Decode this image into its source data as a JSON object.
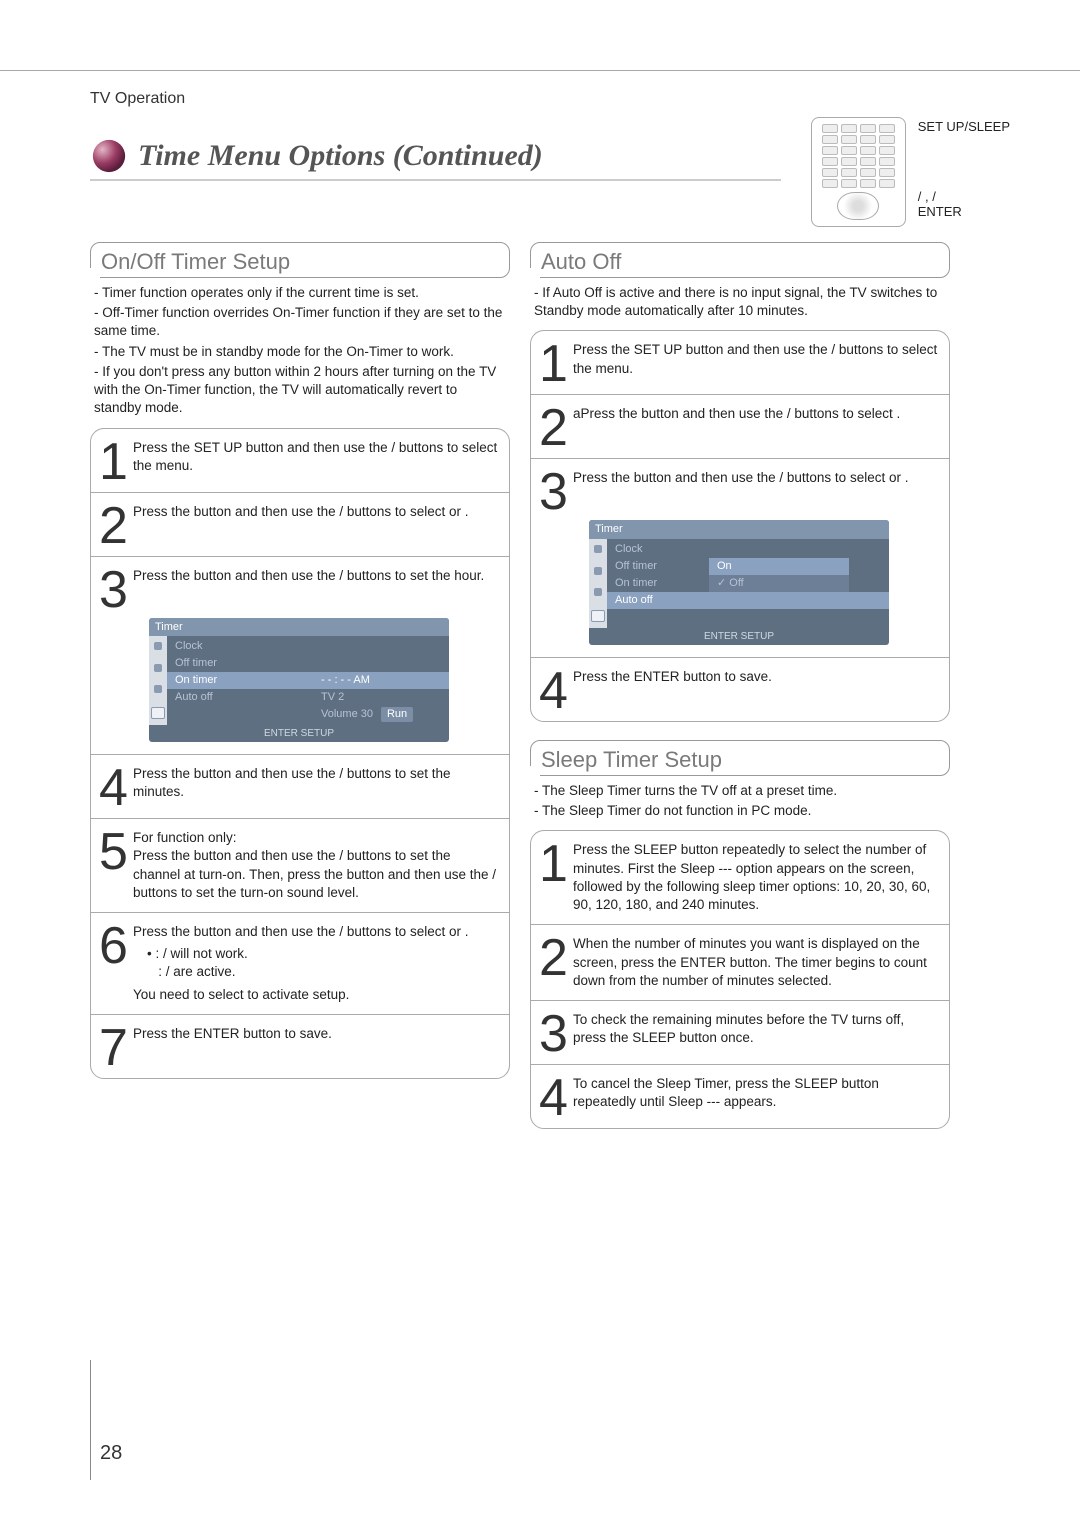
{
  "breadcrumb": "TV Operation",
  "page_title": "Time Menu Options (Continued)",
  "page_number": "28",
  "remote": {
    "label1": "SET UP/SLEEP",
    "label2": "/   ,     /",
    "label3": "ENTER"
  },
  "onoff": {
    "heading": "On/Off Timer Setup",
    "intro": [
      "Timer function operates only if the current time is set.",
      "Off-Timer function overrides On-Timer function if they are set to the same time.",
      "The TV must be in standby mode for the On-Timer to work.",
      "If you don't press any button within 2 hours after turning on the TV with the On-Timer function, the TV will automatically revert to standby mode."
    ],
    "steps": [
      "Press the SET UP button and then use the      /      buttons to select the           menu.",
      "Press the        button and then use the      /      buttons to select                 or               .",
      "Press the        button and then use the      /      buttons to set the hour.",
      "Press the        button and then use the      /      buttons to set the minutes.",
      "For               function only:\nPress the        button and then use the      /      buttons to set the channel at turn-on. Then, press the        button and then use the      /      buttons to set the turn-on sound level.",
      "Press the        button and then use the      /      buttons to select         or       .",
      "Press the ENTER button to save."
    ],
    "step6_bullets": [
      "       :               /               will not work.",
      "    :          /               are active."
    ],
    "step6_note": "You need to select         to activate                 setup.",
    "osd": {
      "title": "Timer",
      "items": [
        "Clock",
        "Off timer",
        "On timer",
        "Auto off"
      ],
      "hl": "On timer",
      "right1": "- - : - -    AM",
      "right2": "TV   2",
      "right3": "Volume    30",
      "run": "Run",
      "footer": "ENTER   SETUP"
    }
  },
  "autooff": {
    "heading": "Auto Off",
    "intro": [
      "If Auto Off is active and there is no input signal, the TV switches to Standby mode automatically after 10 minutes."
    ],
    "steps": [
      "Press the SET UP button and then use the      /      buttons to select the           menu.",
      "aPress the        button and then use the      /      buttons to select             .",
      "Press the        button and then use the      /      buttons to select         or       .",
      "Press the ENTER button to save."
    ],
    "osd": {
      "title": "Timer",
      "items": [
        "Clock",
        "Off timer",
        "On timer",
        "Auto off"
      ],
      "hl": "Auto off",
      "opt_on": "On",
      "opt_off": "✓ Off",
      "footer": "ENTER   SETUP"
    }
  },
  "sleep": {
    "heading": "Sleep Timer Setup",
    "intro": [
      "The Sleep Timer turns the TV off at a preset time.",
      "The Sleep Timer do not function in PC mode."
    ],
    "steps": [
      "Press the SLEEP button repeatedly to select the number of minutes. First the  Sleep  ---  option appears on the screen, followed by the following sleep timer options: 10, 20, 30, 60, 90, 120, 180, and 240 minutes.",
      "When the number of minutes you want is displayed on the screen, press the ENTER button. The timer begins to count down from the number of minutes selected.",
      "To check the remaining minutes before the TV turns off, press the SLEEP button once.",
      "To cancel the Sleep Timer, press the SLEEP button repeatedly until Sleep --- appears."
    ]
  }
}
